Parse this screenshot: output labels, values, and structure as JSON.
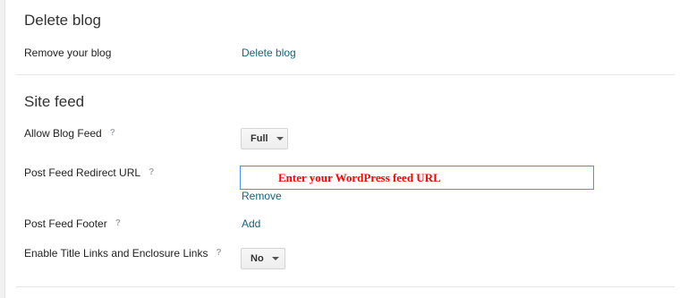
{
  "delete_blog": {
    "title": "Delete blog",
    "remove_label": "Remove your blog",
    "delete_link": "Delete blog"
  },
  "site_feed": {
    "title": "Site feed",
    "help_glyph": "?",
    "allow_blog_feed": {
      "label": "Allow Blog Feed",
      "value": "Full"
    },
    "post_feed_redirect": {
      "label": "Post Feed Redirect URL",
      "input_value": "Enter your WordPress feed URL",
      "remove_link": "Remove"
    },
    "post_feed_footer": {
      "label": "Post Feed Footer",
      "add_link": "Add"
    },
    "title_links": {
      "label": "Enable Title Links and Enclosure Links",
      "value": "No"
    }
  },
  "colors": {
    "link": "#15657c",
    "input_text": "#ff0000",
    "input_focus_border": "#4d90fe"
  }
}
